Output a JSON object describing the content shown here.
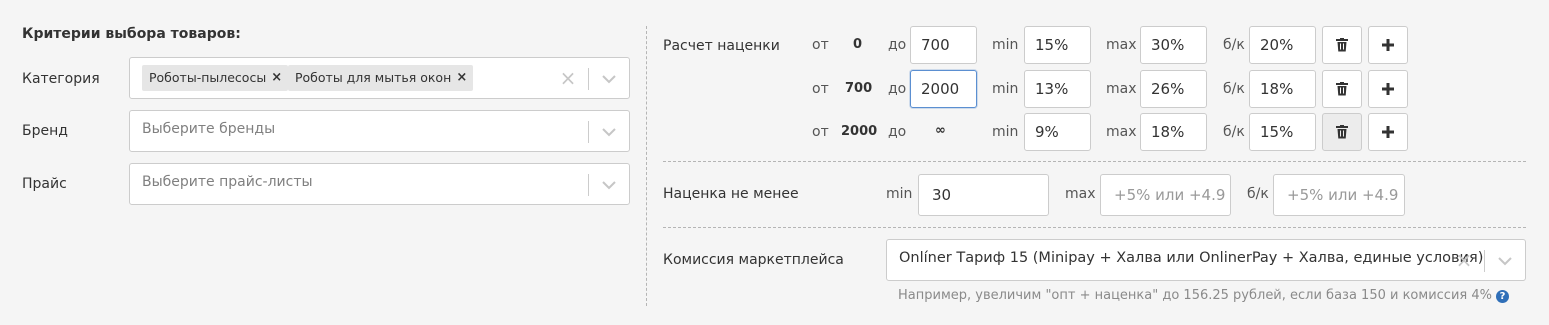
{
  "criteria": {
    "title": "Критерии выбора товаров:",
    "category": {
      "label": "Категория",
      "tags": [
        "Роботы-пылесосы",
        "Роботы для мытья окон"
      ]
    },
    "brand": {
      "label": "Бренд",
      "placeholder": "Выберите бренды"
    },
    "price_list": {
      "label": "Прайс",
      "placeholder": "Выберите прайс-листы"
    }
  },
  "markup": {
    "title": "Расчет наценки",
    "from_label": "от",
    "to_label": "до",
    "min_label": "min",
    "max_label": "max",
    "bk_label": "б/к",
    "infinity": "∞",
    "rows": [
      {
        "from": "0",
        "to": "700",
        "min": "15%",
        "max": "30%",
        "bk": "20%"
      },
      {
        "from": "700",
        "to": "2000",
        "min": "13%",
        "max": "26%",
        "bk": "18%"
      },
      {
        "from": "2000",
        "to": "",
        "min": "9%",
        "max": "18%",
        "bk": "15%"
      }
    ]
  },
  "min_markup": {
    "label": "Наценка не менее",
    "min_label": "min",
    "min_value": "30",
    "max_label": "max",
    "max_placeholder": "+5% или +4.9",
    "bk_label": "б/к",
    "bk_placeholder": "+5% или +4.9"
  },
  "commission": {
    "label": "Комиссия маркетплейса",
    "value": "Onlíner Тариф 15 (Minipay + Халва или OnlinerPay + Халва, единые условия)",
    "hint": "Например, увеличим \"опт + наценка\" до 156.25 рублей, если база 150 и комиссия 4%"
  },
  "colors": {
    "accent": "#2f6fb8",
    "focus_border": "#5b8fd1"
  }
}
